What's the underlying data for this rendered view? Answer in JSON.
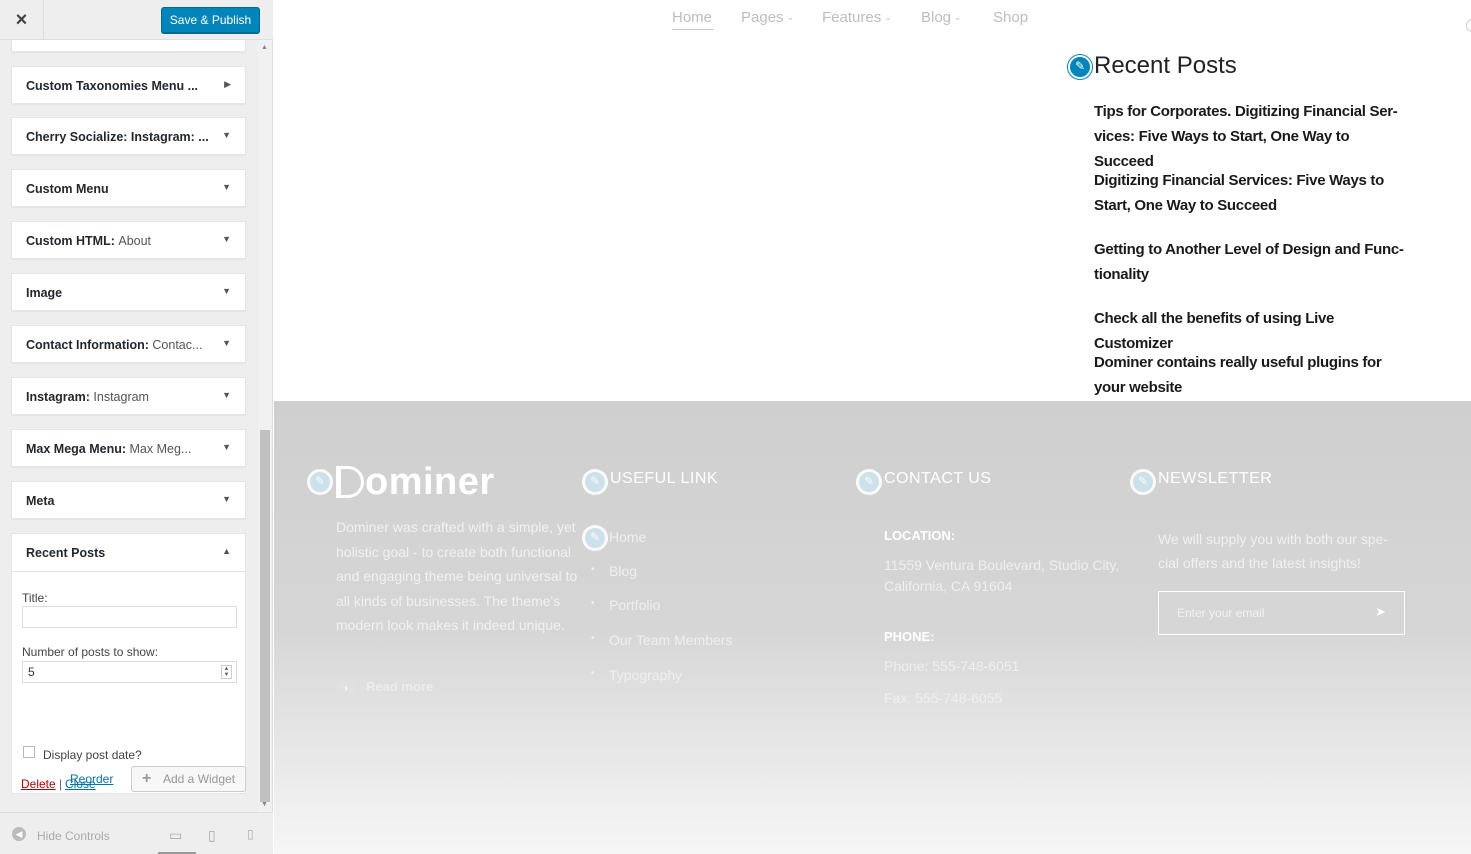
{
  "sidebar": {
    "close_icon": "×",
    "publish_label": "Save & Publish",
    "widgets": [
      {
        "title": "Custom Taxonomies Menu ...",
        "sub": "",
        "arrow": "▶"
      },
      {
        "title": "Cherry Socialize: Instagram: ...",
        "sub": "",
        "arrow": "▼"
      },
      {
        "title": "Custom Menu",
        "sub": "",
        "arrow": "▼"
      },
      {
        "title": "Custom HTML:",
        "sub": "About",
        "arrow": "▼"
      },
      {
        "title": "Image",
        "sub": "",
        "arrow": "▼"
      },
      {
        "title": "Contact Information:",
        "sub": "Contac...",
        "arrow": "▼"
      },
      {
        "title": "Instagram:",
        "sub": "Instagram",
        "arrow": "▼"
      },
      {
        "title": "Max Mega Menu:",
        "sub": "Max Meg...",
        "arrow": "▼"
      },
      {
        "title": "Meta",
        "sub": "",
        "arrow": "▼"
      }
    ],
    "recent_posts": {
      "title": "Recent Posts",
      "arrow": "▲",
      "title_label": "Title:",
      "title_value": "",
      "count_label": "Number of posts to show:",
      "count_value": "5",
      "date_label": "Display post date?",
      "delete_label": "Delete",
      "separator": "|",
      "close_label": "Close"
    },
    "reorder_label": "Reorder",
    "add_widget_label": "Add a Widget",
    "hide_controls_label": "Hide Controls"
  },
  "preview": {
    "nav": [
      {
        "label": "Home",
        "has_chevron": false
      },
      {
        "label": "Pages",
        "has_chevron": true
      },
      {
        "label": "Features",
        "has_chevron": true
      },
      {
        "label": "Blog",
        "has_chevron": true
      },
      {
        "label": "Shop",
        "has_chevron": false
      }
    ],
    "recent_posts_title": "Recent Posts",
    "posts": [
      "Tips for Corporates. Digitizing Financial Ser-vices: Five Ways to Start, One Way to Succeed",
      "Digitizing Financial Services: Five Ways to Start, One Way to Succeed",
      "Getting to Another Level of Design and Func-tionality",
      "Check all the benefits of using Live Customizer",
      "Dominer contains really useful plugins for your website"
    ],
    "footer": {
      "logo_text": "ominer",
      "about": "Dominer was crafted with a simple, yet holistic goal - to create both functional and engaging theme being universal to all kinds of businesses. The theme's modern look makes it indeed unique.",
      "read_more": "Read more",
      "useful_link_title": "USEFUL LINK",
      "links": [
        "Home",
        "Blog",
        "Portfolio",
        "Our Team Members",
        "Typography"
      ],
      "contact_title": "CONTACT US",
      "location_label": "LOCATION:",
      "address_line1": "11559 Ventura Boulevard, Studio City,",
      "address_line2": "California, CA 91604",
      "phone_label": "PHONE:",
      "phone": "Phone: 555-748-6051",
      "fax": "Fax: 555-748-6055",
      "newsletter_title": "NEWSLETTER",
      "newsletter_text": "We will supply you with both our spe-cial offers and the latest insights!",
      "email_placeholder": "Enter your email"
    }
  },
  "colors": {
    "accent": "#0085ba",
    "delete": "#aa0000",
    "link": "#0073aa"
  }
}
